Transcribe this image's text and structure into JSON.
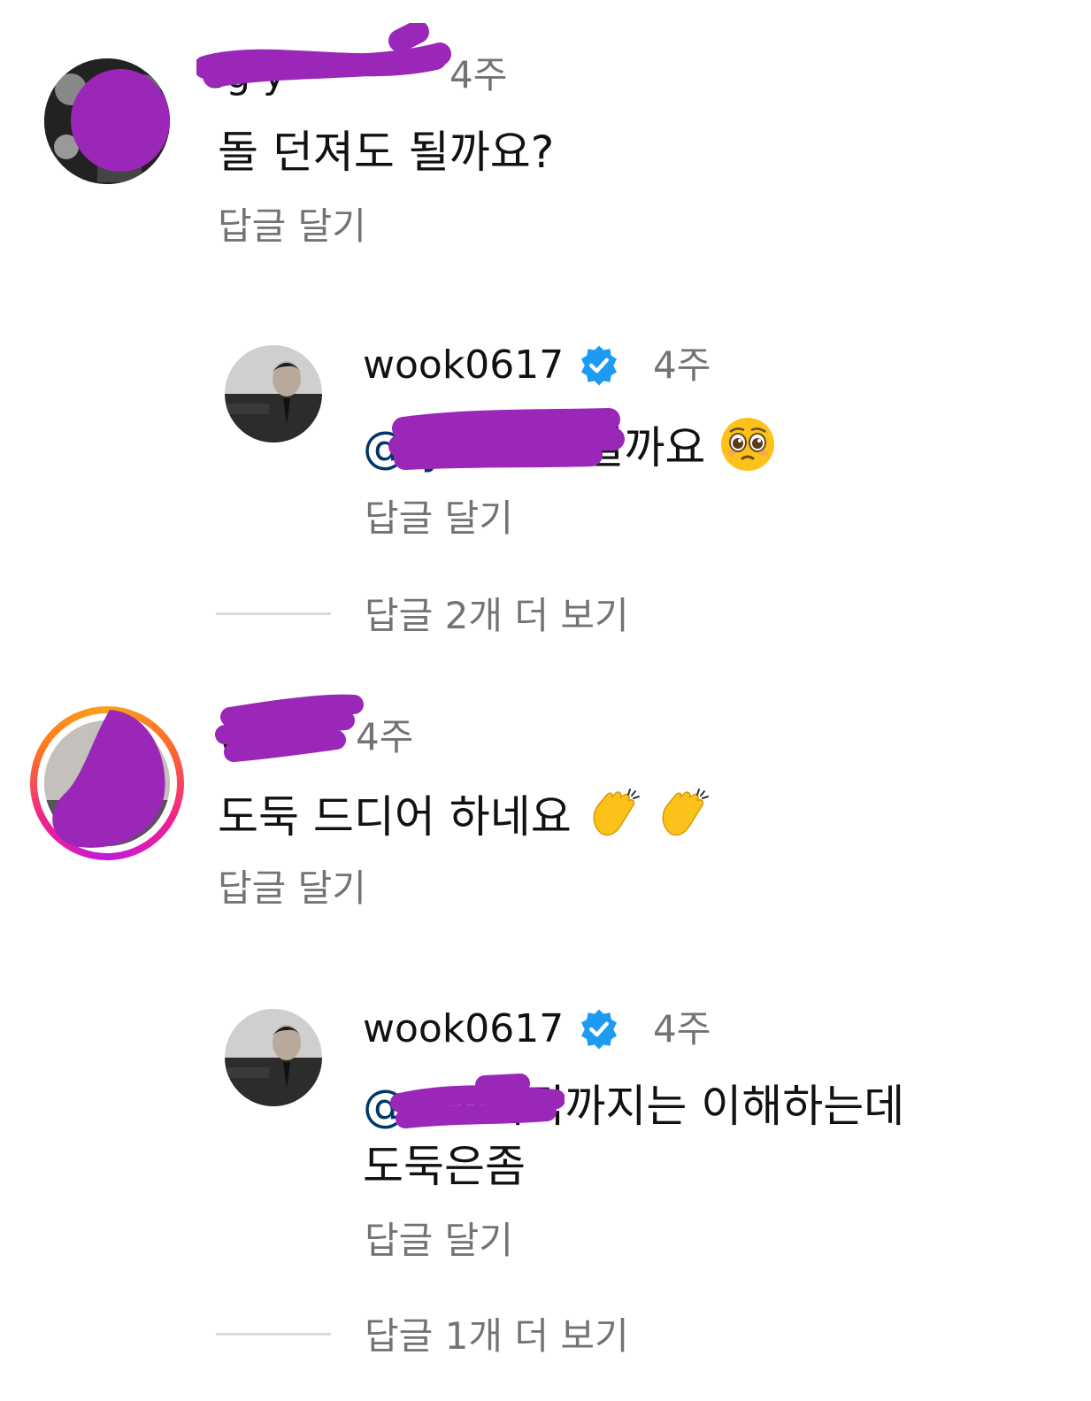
{
  "colors": {
    "censor": "#9b27b8",
    "link": "#00376b",
    "muted": "#737373",
    "verified": "#1d9bf0"
  },
  "comments": [
    {
      "username_visible": "eg         y",
      "time": "4주",
      "text": "돌 던져도 될까요?",
      "reply_label": "답글 달기",
      "avatar": "dark-photo",
      "replies": [
        {
          "username": "wook0617",
          "verified_icon": "verified-badge-icon",
          "time": "4주",
          "mention": "@          y",
          "text": " 피해도될까요",
          "emoji": "pleading-face-emoji",
          "reply_label": "답글 달기"
        }
      ],
      "view_more": "답글 2개 더 보기"
    },
    {
      "username_visible": "w       a",
      "time": "4주",
      "text": "도둑 드디어 하네요",
      "emoji": "clapping-hands-emoji",
      "reply_label": "답글 달기",
      "avatar": "story-ring",
      "replies": [
        {
          "username": "wook0617",
          "verified_icon": "verified-badge-icon",
          "time": "4주",
          "mention": "@w        v",
          "text_line1": "해적까지는 이해하는데",
          "text_line2": "도둑은좀",
          "reply_label": "답글 달기"
        }
      ],
      "view_more": "답글 1개 더 보기"
    }
  ]
}
